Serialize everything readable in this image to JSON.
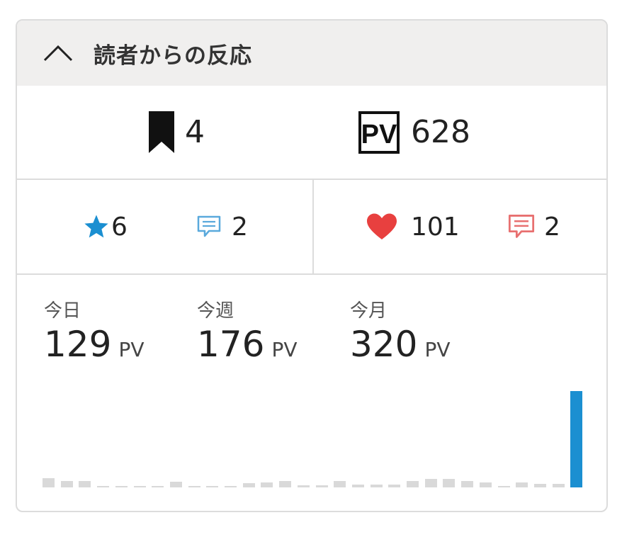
{
  "header": {
    "title": "読者からの反応",
    "icon": "chevron-up-icon"
  },
  "summary": {
    "bookmarks": "4",
    "pageviews": "628",
    "pv_badge": "PV"
  },
  "reactions": {
    "stars": "6",
    "star_comments": "2",
    "likes": "101",
    "like_comments": "2"
  },
  "pv_stats": [
    {
      "label": "今日",
      "value": "129",
      "unit": "PV"
    },
    {
      "label": "今週",
      "value": "176",
      "unit": "PV"
    },
    {
      "label": "今月",
      "value": "320",
      "unit": "PV"
    }
  ],
  "colors": {
    "star": "#1b8fd1",
    "comment_blue": "#5aa9dc",
    "heart": "#e8403f",
    "comment_red": "#e87070",
    "bar_gray": "#d9d9d9",
    "bar_today": "#1b8fd1"
  },
  "chart_data": {
    "type": "bar",
    "values": [
      12,
      9,
      9,
      2,
      2,
      2,
      2,
      8,
      2,
      2,
      2,
      6,
      7,
      9,
      3,
      3,
      9,
      4,
      4,
      4,
      9,
      11,
      11,
      9,
      7,
      2,
      7,
      5,
      5,
      129
    ]
  }
}
